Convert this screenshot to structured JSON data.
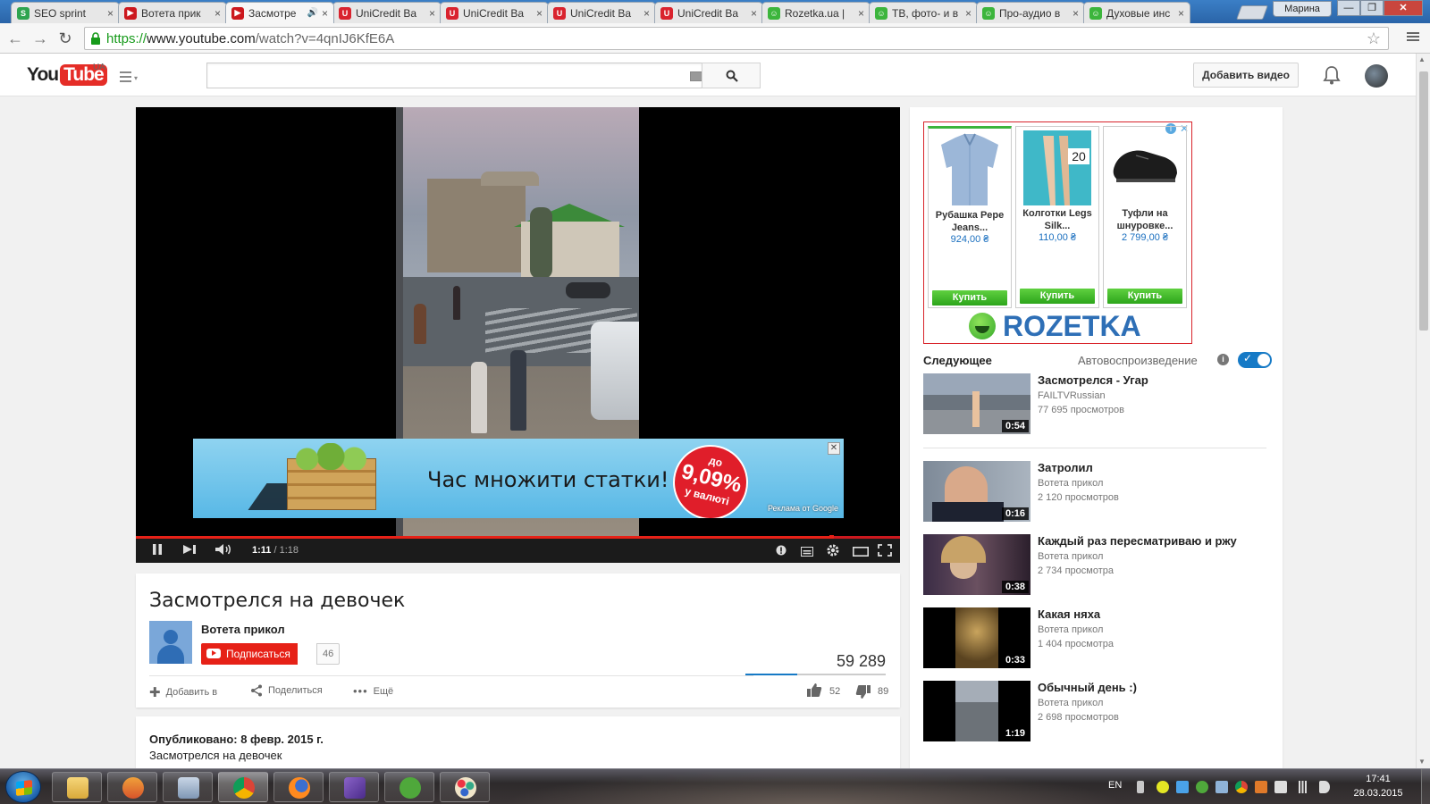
{
  "browser": {
    "tabs": [
      {
        "label": "SEO sprint",
        "favicon_color": "#2ea44f",
        "favicon_glyph": "S"
      },
      {
        "label": "Вотета прик",
        "favicon_color": "#cc181e",
        "favicon_glyph": "▶"
      },
      {
        "label": "Засмотре",
        "favicon_color": "#cc181e",
        "favicon_glyph": "▶",
        "active": true,
        "audio_icon": "speaker-icon"
      },
      {
        "label": "UniCredit Ba",
        "favicon_color": "#d9232e",
        "favicon_glyph": "U"
      },
      {
        "label": "UniCredit Ba",
        "favicon_color": "#d9232e",
        "favicon_glyph": "U"
      },
      {
        "label": "UniCredit Ba",
        "favicon_color": "#d9232e",
        "favicon_glyph": "U"
      },
      {
        "label": "UniCredit Ba",
        "favicon_color": "#d9232e",
        "favicon_glyph": "U"
      },
      {
        "label": "Rozetka.ua |",
        "favicon_color": "#3cb53c",
        "favicon_glyph": "☺"
      },
      {
        "label": "ТВ, фото- и в",
        "favicon_color": "#3cb53c",
        "favicon_glyph": "☺"
      },
      {
        "label": "Про-аудио в",
        "favicon_color": "#3cb53c",
        "favicon_glyph": "☺"
      },
      {
        "label": "Духовые инс",
        "favicon_color": "#3cb53c",
        "favicon_glyph": "☺"
      }
    ],
    "user_name": "Марина",
    "window_controls": {
      "minimize": "—",
      "maximize": "❐",
      "close": "✕"
    },
    "url_scheme": "https://",
    "url_host": "www.youtube.com",
    "url_path": "/watch?v=4qnIJ6KfE6A"
  },
  "masthead": {
    "logo_you": "You",
    "logo_tube": "Tube",
    "region": "UA",
    "search_placeholder": "",
    "upload_label": "Добавить видео"
  },
  "player": {
    "current_time": "1:11",
    "duration": "1:18",
    "played_fraction": 0.91,
    "ad": {
      "headline": "Час множити статки!",
      "badge_top": "до",
      "badge_value": "9,09%",
      "badge_bottom": "у валюті",
      "by_google": "Реклама от Google",
      "close": "✕"
    }
  },
  "video": {
    "title": "Засмотрелся на девочек",
    "channel": "Вотета прикол",
    "subscribe_label": "Подписаться",
    "subscriber_count": "46",
    "views": "59 289",
    "likes": "52",
    "dislikes": "89",
    "like_fraction": 0.37,
    "actions": {
      "add_to": "Добавить в",
      "share": "Поделиться",
      "more": "Ещё"
    },
    "published": "Опубликовано: 8 февр. 2015 г.",
    "description": "Засмотрелся на девочек"
  },
  "rozetka_ad": {
    "info": "i",
    "close": "✕",
    "wordmark": "ROZETKA",
    "products": [
      {
        "name": "Рубашка Pepe Jeans...",
        "price": "924,00 ₴",
        "buy": "Купить"
      },
      {
        "name": "Колготки Legs Silk...",
        "price": "110,00 ₴",
        "buy": "Купить",
        "image_text": "20"
      },
      {
        "name": "Туфли на шнуровке...",
        "price": "2 799,00 ₴",
        "buy": "Купить"
      }
    ]
  },
  "up_next": {
    "label": "Следующее",
    "autoplay_label": "Автовоспроизведение",
    "autoplay_info": "i",
    "autoplay_on": true,
    "items": [
      {
        "title": "Засмотрелся - Угар",
        "channel": "FAILTVRussian",
        "views": "77 695 просмотров",
        "duration": "0:54"
      }
    ]
  },
  "recommendations": [
    {
      "title": "Затролил",
      "channel": "Вотета прикол",
      "views": "2 120 просмотров",
      "duration": "0:16"
    },
    {
      "title": "Каждый раз пересматриваю и ржу",
      "channel": "Вотета прикол",
      "views": "2 734 просмотра",
      "duration": "0:38"
    },
    {
      "title": "Какая няха",
      "channel": "Вотета прикол",
      "views": "1 404 просмотра",
      "duration": "0:33"
    },
    {
      "title": "Обычный день :)",
      "channel": "Вотета прикол",
      "views": "2 698 просмотров",
      "duration": "1:19"
    }
  ],
  "taskbar": {
    "language": "EN",
    "time": "17:41",
    "date": "28.03.2015"
  }
}
